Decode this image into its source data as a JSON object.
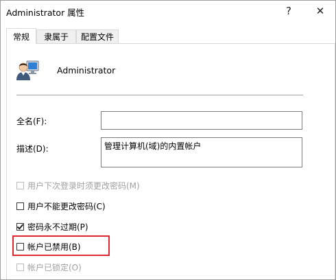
{
  "window": {
    "title": "Administrator 属性",
    "help_glyph": "?",
    "close_glyph": "✕"
  },
  "tabs": [
    {
      "label": "常规",
      "active": true
    },
    {
      "label": "隶属于",
      "active": false
    },
    {
      "label": "配置文件",
      "active": false
    }
  ],
  "general": {
    "user_icon": "user-account-icon",
    "username": "Administrator",
    "fullname": {
      "label": "全名(F):",
      "value": ""
    },
    "description": {
      "label": "描述(D):",
      "value": "管理计算机(域)的内置帐户"
    },
    "checkboxes": [
      {
        "label": "用户下次登录时须更改密码(M)",
        "checked": false,
        "enabled": false
      },
      {
        "label": "用户不能更改密码(C)",
        "checked": false,
        "enabled": true
      },
      {
        "label": "密码永不过期(P)",
        "checked": true,
        "enabled": true
      },
      {
        "label": "帐户已禁用(B)",
        "checked": false,
        "enabled": true
      },
      {
        "label": "帐户已锁定(O)",
        "checked": false,
        "enabled": false
      }
    ]
  },
  "colors": {
    "highlight": "#e0262f",
    "disabled_text": "#a0a0a0"
  }
}
